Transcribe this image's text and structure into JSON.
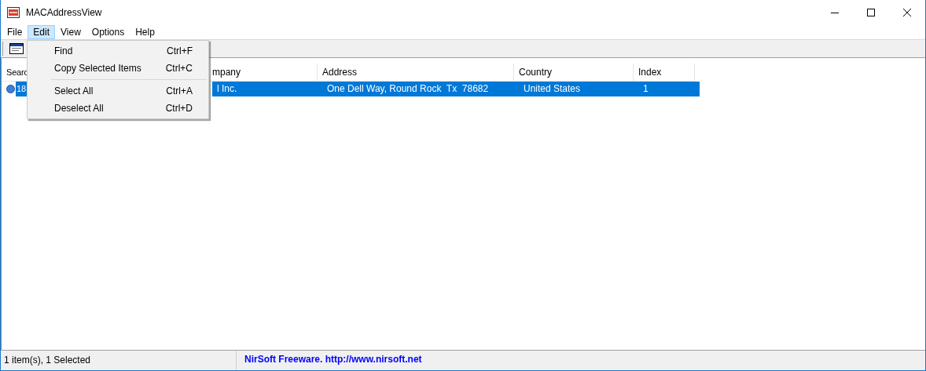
{
  "window": {
    "title": "MACAddressView"
  },
  "menubar": [
    {
      "label": "File",
      "selected": false
    },
    {
      "label": "Edit",
      "selected": true
    },
    {
      "label": "View",
      "selected": false
    },
    {
      "label": "Options",
      "selected": false
    },
    {
      "label": "Help",
      "selected": false
    }
  ],
  "menu": [
    {
      "kind": "item",
      "label": "Find",
      "shortcut": "Ctrl+F"
    },
    {
      "kind": "item",
      "label": "Copy Selected Items",
      "shortcut": "Ctrl+C"
    },
    {
      "kind": "separator"
    },
    {
      "kind": "item",
      "label": "Select All",
      "shortcut": "Ctrl+A"
    },
    {
      "kind": "item",
      "label": "Deselect All",
      "shortcut": "Ctrl+D"
    }
  ],
  "table": {
    "columns": [
      "Searc",
      "mpany",
      "Address",
      "Country",
      "Index"
    ],
    "rows": [
      {
        "selected": true,
        "cells": [
          "18",
          "l Inc.",
          "One Dell Way, Round Rock  Tx  78682",
          "United States",
          "1"
        ]
      }
    ]
  },
  "status_bar": {
    "count": "1 item(s), 1 Selected",
    "credit": "NirSoft Freeware.  http://www.nirsoft.net"
  }
}
